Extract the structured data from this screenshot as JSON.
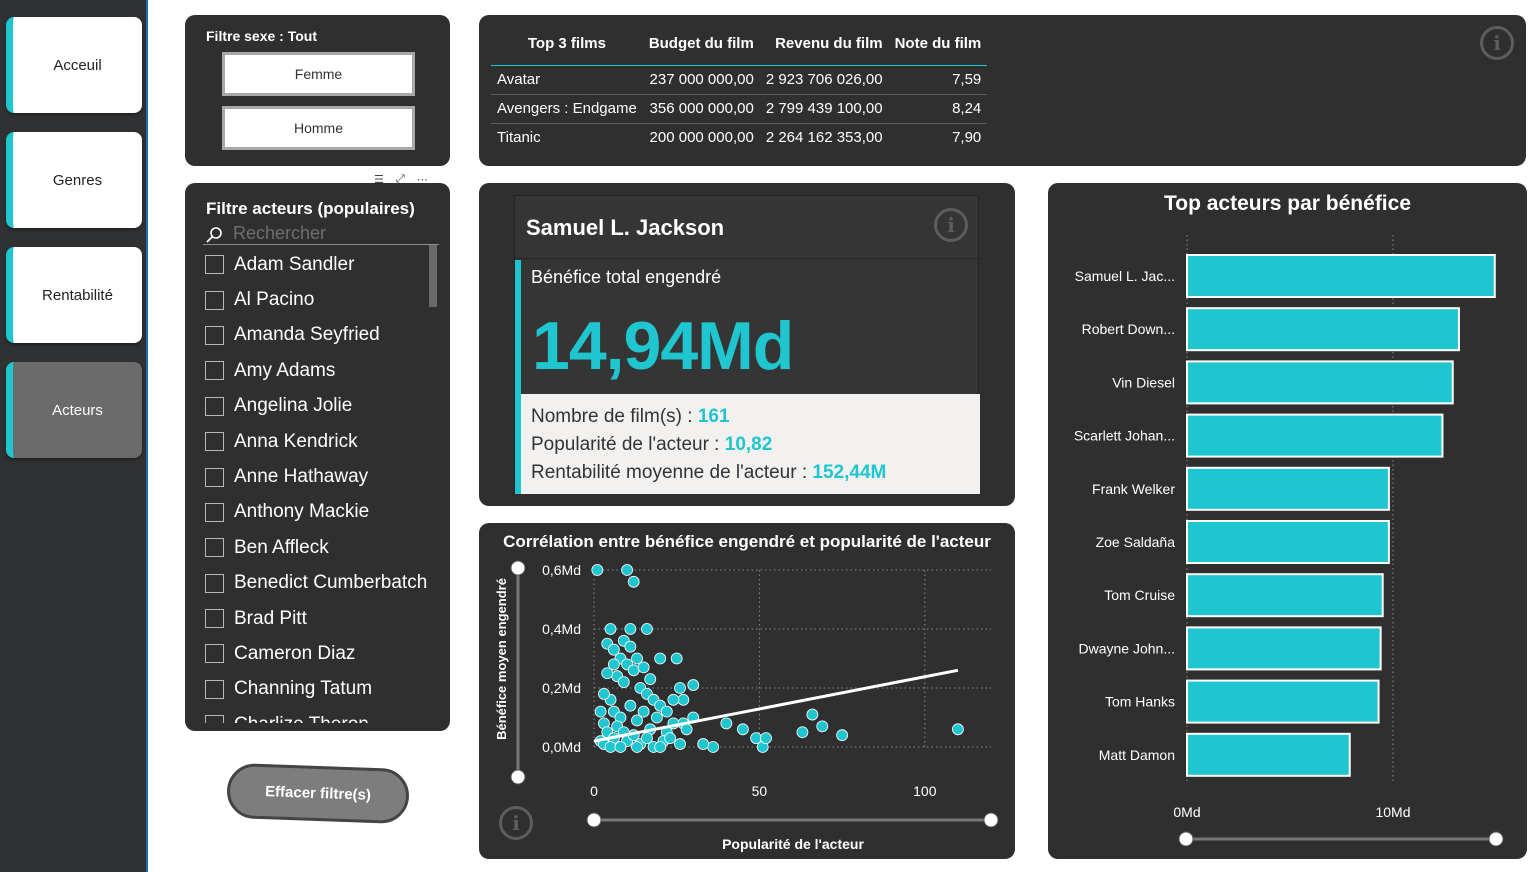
{
  "nav": {
    "items": [
      {
        "label": "Acceuil",
        "active": false
      },
      {
        "label": "Genres",
        "active": false
      },
      {
        "label": "Rentabilité",
        "active": false
      },
      {
        "label": "Acteurs",
        "active": true
      }
    ]
  },
  "sex_filter": {
    "title": "Filtre sexe : Tout",
    "options": [
      "Femme",
      "Homme"
    ]
  },
  "actor_filter": {
    "title": "Filtre acteurs (populaires)",
    "search_placeholder": "Rechercher",
    "actors": [
      "Adam Sandler",
      "Al Pacino",
      "Amanda Seyfried",
      "Amy Adams",
      "Angelina Jolie",
      "Anna Kendrick",
      "Anne Hathaway",
      "Anthony Mackie",
      "Ben Affleck",
      "Benedict Cumberbatch",
      "Brad Pitt",
      "Cameron Diaz",
      "Channing Tatum",
      "Charlize Theron"
    ]
  },
  "clear_button": "Effacer filtre(s)",
  "films_table": {
    "headers": [
      "Top 3 films",
      "Budget du film",
      "Revenu du film",
      "Note du film"
    ],
    "rows": [
      [
        "Avatar",
        "237 000 000,00",
        "2 923 706 026,00",
        "7,59"
      ],
      [
        "Avengers : Endgame",
        "356 000 000,00",
        "2 799 439 100,00",
        "8,24"
      ],
      [
        "Titanic",
        "200 000 000,00",
        "2 264 162 353,00",
        "7,90"
      ]
    ]
  },
  "kpi": {
    "actor_name": "Samuel L. Jackson",
    "label": "Bénéfice total engendré",
    "value": "14,94Md",
    "films_label": "Nombre de film(s) : ",
    "films_value": "161",
    "popularity_label": "Popularité de l'acteur : ",
    "popularity_value": "10,82",
    "profit_label": "Rentabilité moyenne de l'acteur : ",
    "profit_value": "152,44M"
  },
  "colors": {
    "accent": "#20c6cf",
    "panel": "#2f2f2f",
    "nav_bg": "#2f3133"
  },
  "icons": {
    "info": "info-circle-icon",
    "search": "search-icon"
  },
  "chart_data": [
    {
      "type": "scatter",
      "title": "Corrélation entre bénéfice engendré et popularité de l'acteur",
      "xlabel": "Popularité de l'acteur",
      "ylabel": "Bénéfice moyen engendré",
      "xlim": [
        0,
        120
      ],
      "ylim": [
        0,
        0.6
      ],
      "xticks": [
        "0",
        "50",
        "100"
      ],
      "yticks": [
        "0,0Md",
        "0,2Md",
        "0,4Md",
        "0,6Md"
      ],
      "trendline": [
        [
          0,
          0.02
        ],
        [
          110,
          0.26
        ]
      ],
      "points": [
        [
          1,
          0.6
        ],
        [
          10,
          0.6
        ],
        [
          12,
          0.56
        ],
        [
          5,
          0.4
        ],
        [
          11,
          0.4
        ],
        [
          16,
          0.4
        ],
        [
          20,
          0.3
        ],
        [
          25,
          0.3
        ],
        [
          30,
          0.21
        ],
        [
          27,
          0.16
        ],
        [
          27,
          0.08
        ],
        [
          40,
          0.08
        ],
        [
          45,
          0.06
        ],
        [
          49,
          0.03
        ],
        [
          51,
          0.0
        ],
        [
          52,
          0.03
        ],
        [
          63,
          0.05
        ],
        [
          66,
          0.11
        ],
        [
          69,
          0.07
        ],
        [
          75,
          0.04
        ],
        [
          36,
          0.0
        ],
        [
          110,
          0.06
        ],
        [
          4,
          0.35
        ],
        [
          6,
          0.33
        ],
        [
          8,
          0.3
        ],
        [
          10,
          0.28
        ],
        [
          12,
          0.26
        ],
        [
          7,
          0.24
        ],
        [
          9,
          0.22
        ],
        [
          14,
          0.2
        ],
        [
          16,
          0.18
        ],
        [
          18,
          0.16
        ],
        [
          5,
          0.16
        ],
        [
          6,
          0.12
        ],
        [
          8,
          0.1
        ],
        [
          11,
          0.14
        ],
        [
          13,
          0.09
        ],
        [
          15,
          0.12
        ],
        [
          17,
          0.06
        ],
        [
          19,
          0.1
        ],
        [
          22,
          0.05
        ],
        [
          24,
          0.08
        ],
        [
          21,
          0.02
        ],
        [
          26,
          0.01
        ],
        [
          3,
          0.08
        ],
        [
          4,
          0.05
        ],
        [
          6,
          0.03
        ],
        [
          7,
          0.07
        ],
        [
          9,
          0.05
        ],
        [
          10,
          0.02
        ],
        [
          12,
          0.04
        ],
        [
          14,
          0.01
        ],
        [
          16,
          0.03
        ],
        [
          18,
          0.0
        ],
        [
          2,
          0.02
        ],
        [
          3,
          0.01
        ],
        [
          5,
          0.0
        ],
        [
          8,
          0.0
        ],
        [
          13,
          0.0
        ],
        [
          20,
          0.0
        ],
        [
          23,
          0.03
        ],
        [
          28,
          0.06
        ],
        [
          30,
          0.1
        ],
        [
          33,
          0.01
        ],
        [
          2,
          0.12
        ],
        [
          3,
          0.18
        ],
        [
          4,
          0.25
        ],
        [
          6,
          0.28
        ],
        [
          9,
          0.36
        ],
        [
          11,
          0.34
        ],
        [
          13,
          0.3
        ],
        [
          15,
          0.27
        ],
        [
          17,
          0.23
        ],
        [
          20,
          0.14
        ],
        [
          22,
          0.12
        ],
        [
          24,
          0.16
        ],
        [
          26,
          0.2
        ]
      ]
    },
    {
      "type": "bar",
      "orientation": "horizontal",
      "title": "Top acteurs par bénéfice",
      "categories": [
        "Samuel L. Jac...",
        "Robert Down...",
        "Vin Diesel",
        "Scarlett Johan...",
        "Frank Welker",
        "Zoe Saldaña",
        "Tom Cruise",
        "Dwayne John...",
        "Tom Hanks",
        "Matt Damon"
      ],
      "values": [
        14.94,
        13.2,
        12.9,
        12.4,
        9.8,
        9.8,
        9.5,
        9.4,
        9.3,
        7.9
      ],
      "xticks": [
        "0Md",
        "10Md"
      ],
      "xlim": [
        0,
        20
      ],
      "unit": "Md"
    }
  ]
}
